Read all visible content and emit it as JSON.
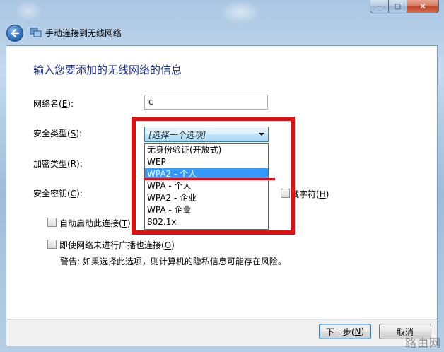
{
  "window": {
    "title": "手动连接到无线网络",
    "caption": {
      "minimize": "─",
      "maximize": "□",
      "close": "✕"
    }
  },
  "form": {
    "heading": "输入您要添加的无线网络的信息",
    "network_name": {
      "label_pre": "网络名(",
      "key": "E",
      "label_post": "):",
      "value": "c"
    },
    "security_type": {
      "label_pre": "安全类型(",
      "key": "S",
      "label_post": "):",
      "selected": "[选择一个选项]"
    },
    "encryption_type": {
      "label_pre": "加密类型(",
      "key": "R",
      "label_post": "):"
    },
    "security_key": {
      "label_pre": "安全密钥(",
      "key": "C",
      "label_post": "):"
    },
    "hide_chars": {
      "label_pre": "隐藏字符(",
      "key": "H",
      "label_post": ")",
      "visible_text": "藏字符(",
      "checked": false
    },
    "auto_start": {
      "label_pre": "自动启动此连接(",
      "key": "T",
      "label_post": ")",
      "checked": false
    },
    "connect_hidden": {
      "label_pre": "即使网络未进行广播也连接(",
      "key": "O",
      "label_post": ")",
      "checked": false
    },
    "warning": "警告: 如果选择此选项，则计算机的隐私信息可能存在风险。"
  },
  "dropdown": {
    "options": [
      "无身份验证(开放式)",
      "WEP",
      "WPA2 - 个人",
      "WPA - 个人",
      "WPA2 - 企业",
      "WPA - 企业",
      "802.1x"
    ],
    "highlighted": "WPA2 - 个人"
  },
  "buttons": {
    "next": {
      "pre": "下一步(",
      "key": "N",
      "post": ")"
    },
    "cancel": "取消"
  },
  "annotation_color": "#e01010",
  "watermark": "路由网"
}
